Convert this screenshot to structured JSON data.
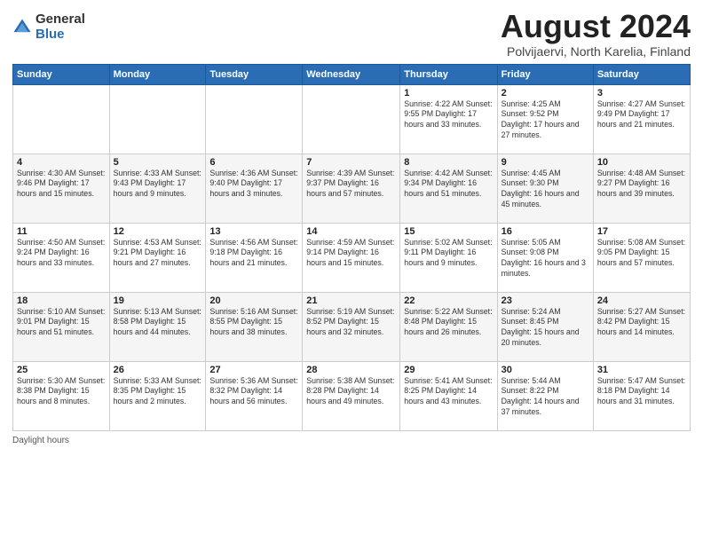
{
  "header": {
    "logo_general": "General",
    "logo_blue": "Blue",
    "title": "August 2024",
    "subtitle": "Polvijaervi, North Karelia, Finland"
  },
  "calendar": {
    "weekdays": [
      "Sunday",
      "Monday",
      "Tuesday",
      "Wednesday",
      "Thursday",
      "Friday",
      "Saturday"
    ],
    "weeks": [
      [
        {
          "day": "",
          "info": ""
        },
        {
          "day": "",
          "info": ""
        },
        {
          "day": "",
          "info": ""
        },
        {
          "day": "",
          "info": ""
        },
        {
          "day": "1",
          "info": "Sunrise: 4:22 AM\nSunset: 9:55 PM\nDaylight: 17 hours and 33 minutes."
        },
        {
          "day": "2",
          "info": "Sunrise: 4:25 AM\nSunset: 9:52 PM\nDaylight: 17 hours and 27 minutes."
        },
        {
          "day": "3",
          "info": "Sunrise: 4:27 AM\nSunset: 9:49 PM\nDaylight: 17 hours and 21 minutes."
        }
      ],
      [
        {
          "day": "4",
          "info": "Sunrise: 4:30 AM\nSunset: 9:46 PM\nDaylight: 17 hours and 15 minutes."
        },
        {
          "day": "5",
          "info": "Sunrise: 4:33 AM\nSunset: 9:43 PM\nDaylight: 17 hours and 9 minutes."
        },
        {
          "day": "6",
          "info": "Sunrise: 4:36 AM\nSunset: 9:40 PM\nDaylight: 17 hours and 3 minutes."
        },
        {
          "day": "7",
          "info": "Sunrise: 4:39 AM\nSunset: 9:37 PM\nDaylight: 16 hours and 57 minutes."
        },
        {
          "day": "8",
          "info": "Sunrise: 4:42 AM\nSunset: 9:34 PM\nDaylight: 16 hours and 51 minutes."
        },
        {
          "day": "9",
          "info": "Sunrise: 4:45 AM\nSunset: 9:30 PM\nDaylight: 16 hours and 45 minutes."
        },
        {
          "day": "10",
          "info": "Sunrise: 4:48 AM\nSunset: 9:27 PM\nDaylight: 16 hours and 39 minutes."
        }
      ],
      [
        {
          "day": "11",
          "info": "Sunrise: 4:50 AM\nSunset: 9:24 PM\nDaylight: 16 hours and 33 minutes."
        },
        {
          "day": "12",
          "info": "Sunrise: 4:53 AM\nSunset: 9:21 PM\nDaylight: 16 hours and 27 minutes."
        },
        {
          "day": "13",
          "info": "Sunrise: 4:56 AM\nSunset: 9:18 PM\nDaylight: 16 hours and 21 minutes."
        },
        {
          "day": "14",
          "info": "Sunrise: 4:59 AM\nSunset: 9:14 PM\nDaylight: 16 hours and 15 minutes."
        },
        {
          "day": "15",
          "info": "Sunrise: 5:02 AM\nSunset: 9:11 PM\nDaylight: 16 hours and 9 minutes."
        },
        {
          "day": "16",
          "info": "Sunrise: 5:05 AM\nSunset: 9:08 PM\nDaylight: 16 hours and 3 minutes."
        },
        {
          "day": "17",
          "info": "Sunrise: 5:08 AM\nSunset: 9:05 PM\nDaylight: 15 hours and 57 minutes."
        }
      ],
      [
        {
          "day": "18",
          "info": "Sunrise: 5:10 AM\nSunset: 9:01 PM\nDaylight: 15 hours and 51 minutes."
        },
        {
          "day": "19",
          "info": "Sunrise: 5:13 AM\nSunset: 8:58 PM\nDaylight: 15 hours and 44 minutes."
        },
        {
          "day": "20",
          "info": "Sunrise: 5:16 AM\nSunset: 8:55 PM\nDaylight: 15 hours and 38 minutes."
        },
        {
          "day": "21",
          "info": "Sunrise: 5:19 AM\nSunset: 8:52 PM\nDaylight: 15 hours and 32 minutes."
        },
        {
          "day": "22",
          "info": "Sunrise: 5:22 AM\nSunset: 8:48 PM\nDaylight: 15 hours and 26 minutes."
        },
        {
          "day": "23",
          "info": "Sunrise: 5:24 AM\nSunset: 8:45 PM\nDaylight: 15 hours and 20 minutes."
        },
        {
          "day": "24",
          "info": "Sunrise: 5:27 AM\nSunset: 8:42 PM\nDaylight: 15 hours and 14 minutes."
        }
      ],
      [
        {
          "day": "25",
          "info": "Sunrise: 5:30 AM\nSunset: 8:38 PM\nDaylight: 15 hours and 8 minutes."
        },
        {
          "day": "26",
          "info": "Sunrise: 5:33 AM\nSunset: 8:35 PM\nDaylight: 15 hours and 2 minutes."
        },
        {
          "day": "27",
          "info": "Sunrise: 5:36 AM\nSunset: 8:32 PM\nDaylight: 14 hours and 56 minutes."
        },
        {
          "day": "28",
          "info": "Sunrise: 5:38 AM\nSunset: 8:28 PM\nDaylight: 14 hours and 49 minutes."
        },
        {
          "day": "29",
          "info": "Sunrise: 5:41 AM\nSunset: 8:25 PM\nDaylight: 14 hours and 43 minutes."
        },
        {
          "day": "30",
          "info": "Sunrise: 5:44 AM\nSunset: 8:22 PM\nDaylight: 14 hours and 37 minutes."
        },
        {
          "day": "31",
          "info": "Sunrise: 5:47 AM\nSunset: 8:18 PM\nDaylight: 14 hours and 31 minutes."
        }
      ]
    ]
  },
  "footer": {
    "note": "Daylight hours"
  }
}
